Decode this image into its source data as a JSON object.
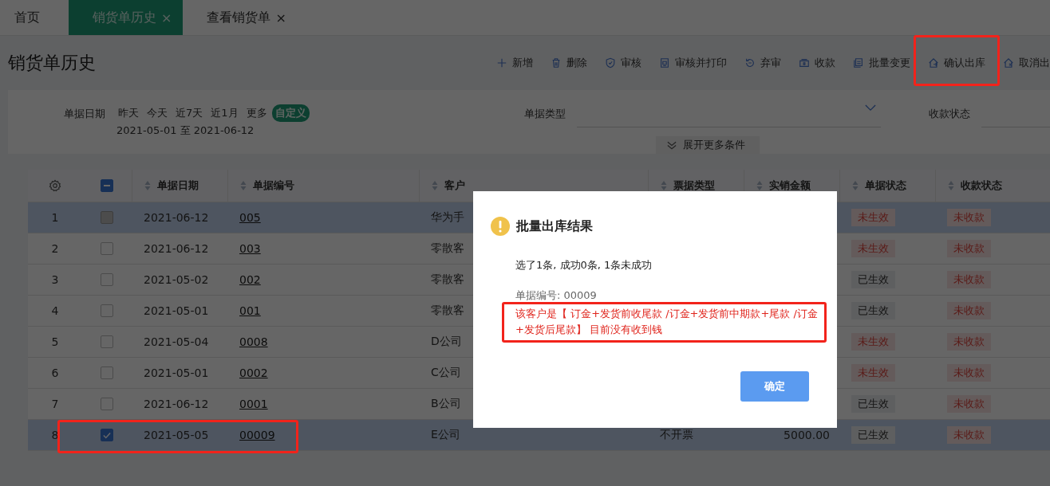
{
  "tabs": [
    {
      "label": "首页",
      "selected": false
    },
    {
      "label": "销货单历史",
      "selected": true,
      "close": "×"
    },
    {
      "label": "查看销货单",
      "selected": false,
      "close": "×"
    }
  ],
  "page_title": "销货单历史",
  "toolbar": [
    {
      "label": "新增",
      "annotated": false
    },
    {
      "label": "删除",
      "annotated": false
    },
    {
      "label": "审核",
      "annotated": false
    },
    {
      "label": "审核并打印",
      "annotated": false
    },
    {
      "label": "弃审",
      "annotated": false
    },
    {
      "label": "收款",
      "annotated": false
    },
    {
      "label": "批量变更",
      "annotated": false
    },
    {
      "label": "确认出库",
      "annotated": true
    },
    {
      "label": "取消出",
      "annotated": false
    }
  ],
  "filters": {
    "date": {
      "label": "单据日期",
      "options": [
        {
          "label": "昨天",
          "selected": false
        },
        {
          "label": "今天",
          "selected": false
        },
        {
          "label": "近7天",
          "selected": false
        },
        {
          "label": "近1月",
          "selected": false
        },
        {
          "label": "更多",
          "selected": false
        },
        {
          "label": "自定义",
          "selected": true
        }
      ],
      "range": "2021-05-01 至 2021-06-12"
    },
    "bill_type": {
      "label": "单据类型"
    },
    "payment_status": {
      "label": "收款状态"
    },
    "expand_button": "展开更多条件"
  },
  "table": {
    "header_checkbox_indeterminate": true,
    "columns": [
      {
        "label": "单据日期",
        "sortable": true
      },
      {
        "label": "单据编号",
        "sortable": true
      },
      {
        "label": "客户",
        "sortable": true
      },
      {
        "label": "票据类型",
        "sortable": true
      },
      {
        "label": "实销金额",
        "sortable": true
      },
      {
        "label": "单据状态",
        "sortable": true
      },
      {
        "label": "收款状态",
        "sortable": true
      }
    ],
    "rows": [
      {
        "index": "1",
        "selected": true,
        "checked": false,
        "disabled": true,
        "annotated": false,
        "date": "2021-06-12",
        "number": "005",
        "customer": "华为手",
        "doc_status": {
          "text": "未生效",
          "kind": "pending"
        },
        "payment_status": {
          "text": "未收款",
          "kind": "unpaid"
        }
      },
      {
        "index": "2",
        "selected": false,
        "checked": false,
        "disabled": false,
        "annotated": false,
        "date": "2021-06-12",
        "number": "003",
        "customer": "零散客",
        "doc_status": {
          "text": "未生效",
          "kind": "pending"
        },
        "payment_status": {
          "text": "未收款",
          "kind": "unpaid"
        }
      },
      {
        "index": "3",
        "selected": false,
        "checked": false,
        "disabled": false,
        "annotated": false,
        "date": "2021-05-02",
        "number": "002",
        "customer": "零散客",
        "doc_status": {
          "text": "已生效",
          "kind": "effective"
        },
        "payment_status": {
          "text": "未收款",
          "kind": "unpaid"
        }
      },
      {
        "index": "4",
        "selected": false,
        "checked": false,
        "disabled": false,
        "annotated": false,
        "date": "2021-05-01",
        "number": "001",
        "customer": "零散客",
        "doc_status": {
          "text": "已生效",
          "kind": "effective"
        },
        "payment_status": {
          "text": "未收款",
          "kind": "unpaid"
        }
      },
      {
        "index": "5",
        "selected": false,
        "checked": false,
        "disabled": false,
        "annotated": false,
        "date": "2021-05-04",
        "number": "0008",
        "customer": "D公司",
        "doc_status": {
          "text": "未生效",
          "kind": "pending"
        },
        "payment_status": {
          "text": "未收款",
          "kind": "unpaid"
        }
      },
      {
        "index": "6",
        "selected": false,
        "checked": false,
        "disabled": false,
        "annotated": false,
        "date": "2021-05-01",
        "number": "0002",
        "customer": "C公司",
        "doc_status": {
          "text": "未生效",
          "kind": "pending"
        },
        "payment_status": {
          "text": "未收款",
          "kind": "unpaid"
        }
      },
      {
        "index": "7",
        "selected": false,
        "checked": false,
        "disabled": false,
        "annotated": false,
        "date": "2021-06-12",
        "number": "0001",
        "customer": "B公司",
        "doc_status": {
          "text": "已生效",
          "kind": "effective"
        },
        "payment_status": {
          "text": "未收款",
          "kind": "unpaid"
        }
      },
      {
        "index": "8",
        "selected": true,
        "checked": true,
        "disabled": false,
        "annotated": true,
        "date": "2021-05-05",
        "number": "00009",
        "customer": "E公司",
        "bill_type": "不开票",
        "amount": "5000.00",
        "doc_status": {
          "text": "已生效",
          "kind": "effective"
        },
        "payment_status": {
          "text": "未收款",
          "kind": "unpaid"
        }
      }
    ]
  },
  "dialog": {
    "title": "批量出库结果",
    "summary": "选了1条, 成功0条, 1条未成功",
    "bill_number": "单据编号: 00009",
    "error": "该客户是【 订金+发货前收尾款 /订金+发货前中期款+尾款 /订金+发货后尾款】 目前没有收到钱",
    "error_annotated": true,
    "ok_button": "确定"
  }
}
